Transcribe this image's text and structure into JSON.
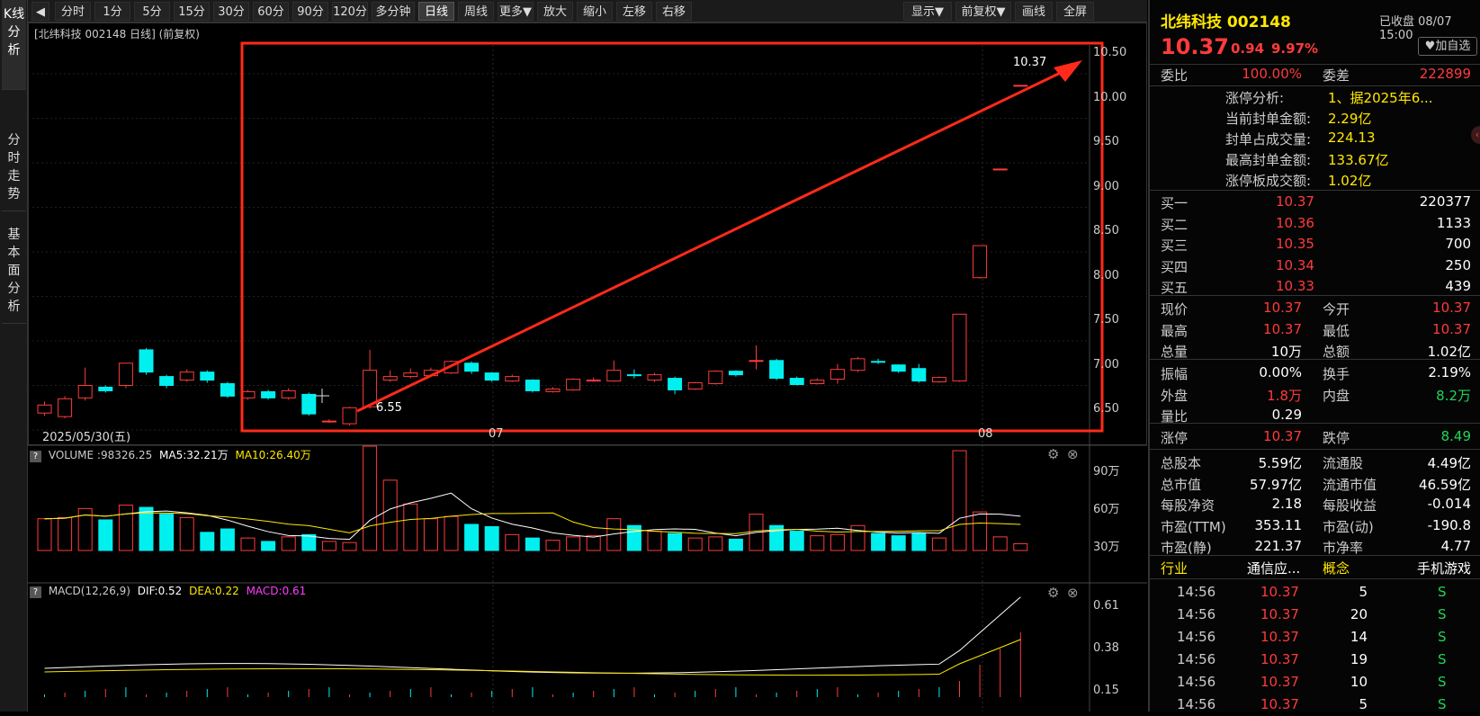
{
  "left_tabs": [
    "K线分析",
    "分时走势",
    "基本面分析"
  ],
  "toolbar": {
    "back_icon": "back-arrow-icon",
    "periods": [
      "分时",
      "1分",
      "5分",
      "15分",
      "30分",
      "60分",
      "90分",
      "120分",
      "多分钟",
      "日线",
      "周线",
      "更多▼",
      "放大",
      "缩小",
      "左移",
      "右移"
    ],
    "active_period": "日线",
    "right_buttons": [
      "显示▼",
      "前复权▼",
      "画线",
      "全屏"
    ]
  },
  "main_chart": {
    "header": "[北纬科技 002148 日线]  (前复权)",
    "y_ticks": [
      "10.50",
      "10.00",
      "9.50",
      "9.00",
      "8.50",
      "8.00",
      "7.50",
      "7.00",
      "6.50"
    ],
    "date_left": "2025/05/30(五)",
    "date_labels": [
      "07",
      "08"
    ],
    "high_label": "10.37",
    "low_label": "6.55"
  },
  "volume_panel": {
    "name": "VOLUME",
    "value": ":98326.25",
    "ma5": "MA5:32.21万",
    "ma10": "MA10:26.40万",
    "y_ticks": [
      "90万",
      "60万",
      "30万"
    ]
  },
  "macd_panel": {
    "name": "MACD(12,26,9)",
    "dif": "DIF:0.52",
    "dea": "DEA:0.22",
    "macd": "MACD:0.61",
    "y_ticks": [
      "0.61",
      "0.38",
      "0.15"
    ]
  },
  "quote": {
    "name": "北纬科技 002148",
    "status": "已收盘 08/07 15:00",
    "price": "10.37",
    "change": "0.94",
    "change_pct": "9.97%",
    "watch_label": "加自选",
    "weibi_label": "委比",
    "weibi": "100.00%",
    "weicha_label": "委差",
    "weicha": "222899",
    "limit_info": [
      {
        "label": "涨停分析:",
        "value": "1、据2025年6..."
      },
      {
        "label": "当前封单金额:",
        "value": "2.29亿"
      },
      {
        "label": "封单占成交量:",
        "value": "224.13"
      },
      {
        "label": "最高封单金额:",
        "value": "133.67亿"
      },
      {
        "label": "涨停板成交额:",
        "value": "1.02亿"
      }
    ],
    "bids": [
      {
        "label": "买一",
        "price": "10.37",
        "vol": "220377"
      },
      {
        "label": "买二",
        "price": "10.36",
        "vol": "1133"
      },
      {
        "label": "买三",
        "price": "10.35",
        "vol": "700"
      },
      {
        "label": "买四",
        "price": "10.34",
        "vol": "250"
      },
      {
        "label": "买五",
        "price": "10.33",
        "vol": "439"
      }
    ],
    "stats1": [
      {
        "l1": "现价",
        "v1": "10.37",
        "l2": "今开",
        "v2": "10.37"
      },
      {
        "l1": "最高",
        "v1": "10.37",
        "l2": "最低",
        "v2": "10.37"
      },
      {
        "l1": "总量",
        "v1": "10万",
        "l2": "总额",
        "v2": "1.02亿"
      }
    ],
    "stats2": [
      {
        "l1": "振幅",
        "v1": "0.00%",
        "l2": "换手",
        "v2": "2.19%"
      },
      {
        "l1": "外盘",
        "v1": "1.8万",
        "l2": "内盘",
        "v2": "8.2万"
      },
      {
        "l1": "量比",
        "v1": "0.29",
        "l2": "",
        "v2": ""
      }
    ],
    "limits": {
      "l1": "涨停",
      "v1": "10.37",
      "l2": "跌停",
      "v2": "8.49"
    },
    "fundamentals": [
      {
        "l1": "总股本",
        "v1": "5.59亿",
        "l2": "流通股",
        "v2": "4.49亿"
      },
      {
        "l1": "总市值",
        "v1": "57.97亿",
        "l2": "流通市值",
        "v2": "46.59亿"
      },
      {
        "l1": "每股净资",
        "v1": "2.18",
        "l2": "每股收益",
        "v2": "-0.014"
      },
      {
        "l1": "市盈(TTM)",
        "v1": "353.11",
        "l2": "市盈(动)",
        "v2": "-190.8"
      },
      {
        "l1": "市盈(静)",
        "v1": "221.37",
        "l2": "市净率",
        "v2": "4.77"
      }
    ],
    "industry": {
      "l1": "行业",
      "v1": "通信应...",
      "l2": "概念",
      "v2": "手机游戏"
    },
    "ticks": [
      {
        "time": "14:56",
        "price": "10.37",
        "vol": "5",
        "side": "S"
      },
      {
        "time": "14:56",
        "price": "10.37",
        "vol": "20",
        "side": "S"
      },
      {
        "time": "14:56",
        "price": "10.37",
        "vol": "14",
        "side": "S"
      },
      {
        "time": "14:56",
        "price": "10.37",
        "vol": "19",
        "side": "S"
      },
      {
        "time": "14:56",
        "price": "10.37",
        "vol": "10",
        "side": "S"
      },
      {
        "time": "14:56",
        "price": "10.37",
        "vol": "5",
        "side": "S"
      }
    ]
  },
  "colors": {
    "up": "#ff3b3b",
    "down": "#00f0f0",
    "ma5": "#ffffff",
    "ma10": "#ffe800",
    "annotation": "#ff2a1a"
  }
}
